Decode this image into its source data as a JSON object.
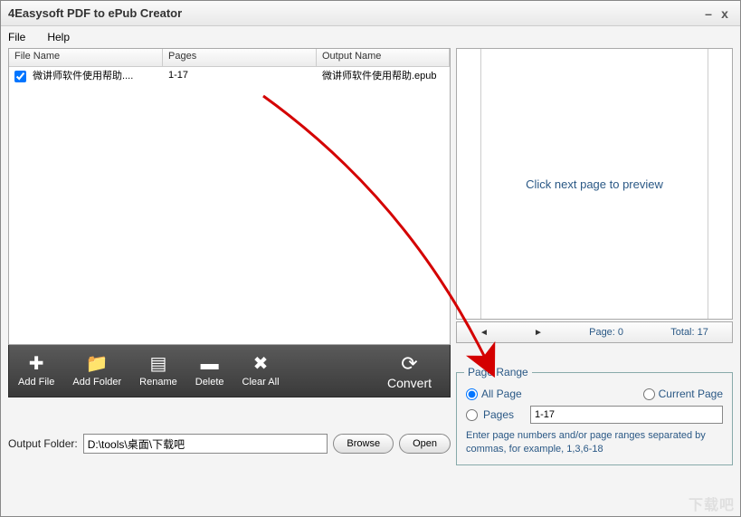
{
  "window": {
    "title": "4Easysoft PDF to ePub Creator"
  },
  "menu": {
    "file": "File",
    "help": "Help"
  },
  "table": {
    "headers": {
      "file": "File Name",
      "pages": "Pages",
      "output": "Output Name"
    },
    "rows": [
      {
        "checked": true,
        "file": "微讲师软件使用帮助....",
        "pages": "1-17",
        "output": "微讲师软件使用帮助.epub"
      }
    ]
  },
  "toolbar": {
    "addFile": "Add File",
    "addFolder": "Add Folder",
    "rename": "Rename",
    "delete": "Delete",
    "clearAll": "Clear All",
    "convert": "Convert"
  },
  "output": {
    "label": "Output Folder:",
    "path": "D:\\tools\\桌面\\下载吧",
    "browse": "Browse",
    "open": "Open"
  },
  "preview": {
    "placeholder": "Click next page to preview",
    "pageLabel": "Page: 0",
    "totalLabel": "Total: 17"
  },
  "pageRange": {
    "legend": "Page Range",
    "allPage": "All Page",
    "currentPage": "Current Page",
    "pages": "Pages",
    "rangeValue": "1-17",
    "hint": "Enter page numbers and/or page ranges separated by commas, for example, 1,3,6-18"
  },
  "watermark": "下载吧"
}
